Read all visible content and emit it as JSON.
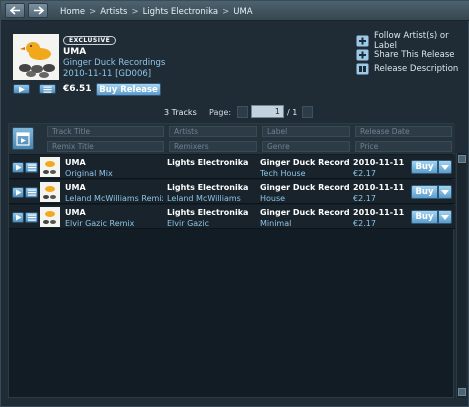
{
  "nav": {
    "breadcrumb": [
      "Home",
      "Artists",
      "Lights Electronika",
      "UMA"
    ],
    "separator": ">"
  },
  "release": {
    "badge": "EXCLUSIVE",
    "title": "UMA",
    "label": "Ginger Duck Recordings",
    "date_catalog": "2010-11-11 [GD006]",
    "price": "€6.51",
    "buy_label": "Buy Release",
    "cover_text": "Lights Electronika"
  },
  "actions": [
    {
      "label": "Follow Artist(s) or Label",
      "icon": "follow-plus-icon"
    },
    {
      "label": "Share This Release",
      "icon": "share-plus-icon"
    },
    {
      "label": "Release Description",
      "icon": "book-icon"
    }
  ],
  "pager": {
    "tracks_count": "3 Tracks",
    "page_label": "Page:",
    "current_page": "1",
    "total": "/ 1"
  },
  "filters": {
    "row1": [
      "Track Title",
      "Artists",
      "Label",
      "Release Date"
    ],
    "row2": [
      "Remix Title",
      "Remixers",
      "Genre",
      "Price"
    ]
  },
  "tracks": [
    {
      "title": "UMA",
      "remix": "Original Mix",
      "artist": "Lights Electronika",
      "remixer": "",
      "label": "Ginger Duck Recordings",
      "genre": "Tech House",
      "date": "2010-11-11",
      "price": "€2.17",
      "buy": "Buy"
    },
    {
      "title": "UMA",
      "remix": "Leland McWilliams Remix",
      "artist": "Lights Electronika",
      "remixer": "Leland McWilliams",
      "label": "Ginger Duck Recordings",
      "genre": "House",
      "date": "2010-11-11",
      "price": "€2.17",
      "buy": "Buy"
    },
    {
      "title": "UMA",
      "remix": "Elvir Gazic Remix",
      "artist": "Lights Electronika",
      "remixer": "Elvir Gazic",
      "label": "Ginger Duck Recordings",
      "genre": "Minimal",
      "date": "2010-11-11",
      "price": "€2.17",
      "buy": "Buy"
    }
  ],
  "colors": {
    "background": "#1f2c36",
    "accent": "#8fc5e8",
    "button": "#5b9dcc"
  }
}
